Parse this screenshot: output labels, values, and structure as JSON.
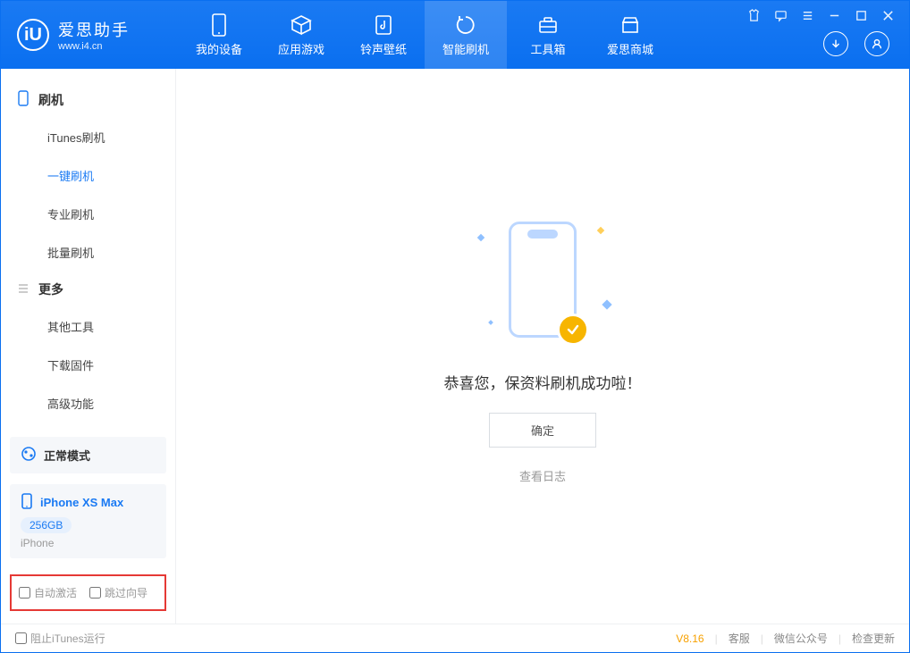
{
  "brand": {
    "name": "爱思助手",
    "site": "www.i4.cn"
  },
  "nav": {
    "items": [
      {
        "label": "我的设备"
      },
      {
        "label": "应用游戏"
      },
      {
        "label": "铃声壁纸"
      },
      {
        "label": "智能刷机"
      },
      {
        "label": "工具箱"
      },
      {
        "label": "爱思商城"
      }
    ]
  },
  "sidebar": {
    "groupA": {
      "title": "刷机",
      "items": [
        "iTunes刷机",
        "一键刷机",
        "专业刷机",
        "批量刷机"
      ]
    },
    "groupB": {
      "title": "更多",
      "items": [
        "其他工具",
        "下载固件",
        "高级功能"
      ]
    },
    "status": {
      "mode": "正常模式"
    },
    "device": {
      "name": "iPhone XS Max",
      "capacity": "256GB",
      "type": "iPhone"
    },
    "checks": {
      "autoActivate": "自动激活",
      "skipWizard": "跳过向导"
    }
  },
  "main": {
    "successMessage": "恭喜您，保资料刷机成功啦！",
    "okLabel": "确定",
    "viewLog": "查看日志"
  },
  "statusbar": {
    "blockItunes": "阻止iTunes运行",
    "version": "V8.16",
    "support": "客服",
    "wechat": "微信公众号",
    "update": "检查更新"
  }
}
